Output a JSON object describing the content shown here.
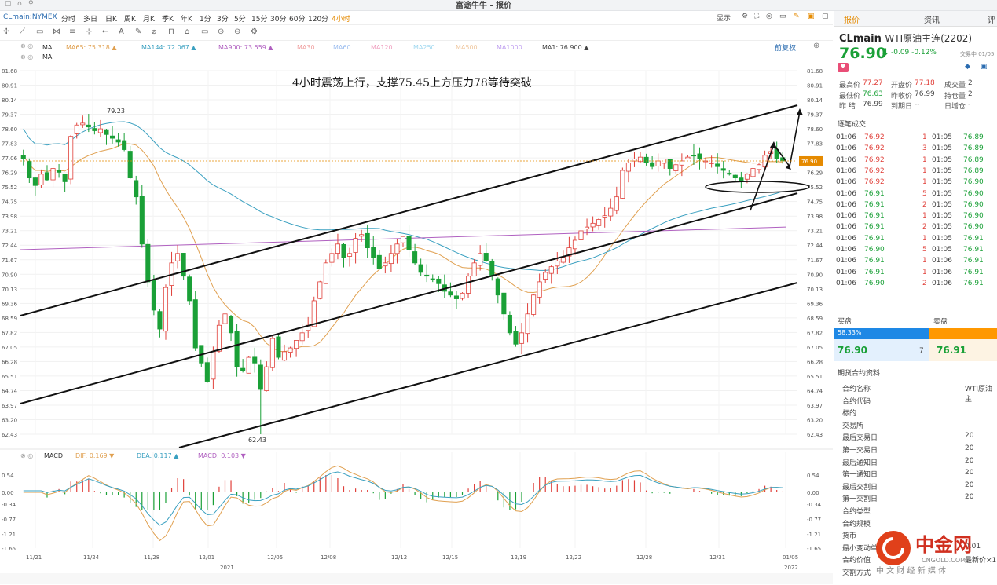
{
  "window_title": "富途牛牛 - 报价",
  "symbol_label": "CLmain:NYMEX",
  "periods": [
    "分时",
    "多日",
    "日K",
    "周K",
    "月K",
    "季K",
    "年K",
    "1分",
    "3分",
    "5分",
    "15分",
    "30分",
    "60分",
    "120分",
    "4小时"
  ],
  "active_period": "4小时",
  "top_right": {
    "display": "显示"
  },
  "toolbar_icons": [
    "cursor-icon",
    "trend-line-icon",
    "rect-icon",
    "fib-icon",
    "channel-icon",
    "measure-icon",
    "arrow-icon",
    "text-icon",
    "pencil-icon",
    "eraser-icon",
    "magnet-icon",
    "lock-icon",
    "delete-icon",
    "eye-icon",
    "layers-icon",
    "settings-icon"
  ],
  "ma_legend_row1": [
    {
      "label": "MA",
      "color": "#333333"
    },
    {
      "label": "MA65: 75.318 ▲",
      "color": "#e0a050"
    },
    {
      "label": "MA144: 72.067 ▲",
      "color": "#3aa0c0"
    },
    {
      "label": "MA900: 73.559 ▲",
      "color": "#b060c0"
    },
    {
      "label": "MA30",
      "color": "#f0a0a0"
    },
    {
      "label": "MA60",
      "color": "#a0c0f0"
    },
    {
      "label": "MA120",
      "color": "#f0a0c0"
    },
    {
      "label": "MA250",
      "color": "#a0d8f0"
    },
    {
      "label": "MA500",
      "color": "#f0c8a0"
    },
    {
      "label": "MA1000",
      "color": "#c0a0f0"
    },
    {
      "label": "MA1: 76.900 ▲",
      "color": "#444444"
    }
  ],
  "ma_legend_row2": "MA",
  "adjust_label": "前复权",
  "annotation_text": "4小时震荡上行，支撑75.45上方压力78等待突破",
  "high_label": "79.23",
  "low_label": "62.43",
  "current_price_tag": "76.90",
  "price_axis": [
    "81.68",
    "80.91",
    "80.14",
    "79.37",
    "78.60",
    "77.83",
    "77.06",
    "76.29",
    "75.52",
    "74.75",
    "73.98",
    "73.21",
    "72.44",
    "71.67",
    "70.90",
    "70.13",
    "69.36",
    "68.59",
    "67.82",
    "67.05",
    "66.28",
    "65.51",
    "64.74",
    "63.97",
    "63.20",
    "62.43"
  ],
  "macd_legend": {
    "name": "MACD",
    "dif": "DIF: 0.169 ▼",
    "dea": "DEA: 0.117 ▲",
    "macd": "MACD: 0.103 ▼"
  },
  "macd_axis": [
    "0.54",
    "0.00",
    "-0.34",
    "-0.77",
    "-1.21",
    "-1.65"
  ],
  "macd_axis_left": [
    "0.54",
    "0.00",
    "-0.34",
    "-0.77",
    "-1.21",
    "-1.65"
  ],
  "dates": [
    "11/21",
    "11/24",
    "11/28",
    "12/01",
    "12/05",
    "12/08",
    "12/12",
    "12/15",
    "12/19",
    "12/22",
    "12/28",
    "12/31",
    "01/05"
  ],
  "year_labels": [
    "2021",
    "2022"
  ],
  "chart_data": {
    "type": "candlestick",
    "title": "4小时震荡上行，支撑75.45上方压力78等待突破",
    "y_range": [
      62.43,
      81.68
    ],
    "close_path": [
      77.0,
      76.0,
      75.6,
      76.2,
      75.9,
      76.5,
      76.3,
      75.8,
      78.2,
      78.8,
      78.9,
      78.7,
      78.5,
      78.6,
      78.3,
      78.1,
      77.9,
      77.5,
      76.0,
      75.0,
      72.5,
      70.5,
      69.0,
      68.0,
      70.2,
      71.5,
      72.0,
      70.8,
      69.5,
      67.0,
      66.2,
      65.2,
      66.8,
      68.2,
      68.8,
      67.8,
      66.0,
      65.8,
      66.5,
      66.2,
      64.8,
      66.0,
      67.5,
      66.5,
      66.8,
      67.0,
      67.4,
      67.8,
      68.2,
      69.5,
      70.5,
      71.5,
      72.0,
      72.5,
      71.8,
      72.0,
      72.8,
      73.0,
      72.3,
      71.8,
      71.2,
      71.5,
      72.0,
      72.5,
      72.9,
      72.2,
      71.5,
      71.0,
      70.8,
      70.6,
      70.4,
      70.0,
      69.8,
      69.6,
      69.9,
      70.8,
      71.5,
      72.0,
      71.6,
      70.8,
      69.8,
      68.8,
      67.8,
      67.2,
      67.8,
      68.8,
      69.8,
      70.5,
      71.0,
      71.3,
      71.6,
      71.8,
      72.3,
      72.7,
      73.2,
      73.4,
      73.6,
      73.8,
      74.0,
      74.4,
      75.0,
      76.4,
      76.8,
      77.0,
      77.1,
      76.8,
      76.6,
      76.9,
      77.0,
      76.5,
      76.7,
      76.9,
      77.1,
      77.2,
      77.0,
      76.9,
      76.8,
      76.6,
      76.4,
      76.2,
      76.0,
      75.8,
      76.2,
      76.5,
      76.7,
      77.2,
      77.4,
      77.0,
      76.9
    ],
    "series": [
      {
        "name": "MA65",
        "last": 75.318
      },
      {
        "name": "MA144",
        "last": 72.067
      },
      {
        "name": "MA900",
        "last": 73.559
      }
    ],
    "support": 75.45,
    "resistance": 78.0
  },
  "right_panel": {
    "tabs": [
      "报价",
      "资讯",
      "评"
    ],
    "contract_code": "CLmain",
    "contract_name": "WTI原油主连(2202)",
    "last_price": "76.90",
    "change": "-0.09  -0.12%",
    "trading_status": "交易中 01/05",
    "stats": [
      {
        "label": "最高价",
        "value": "77.27",
        "cls": "r",
        "x": 6,
        "y": 87
      },
      {
        "label": "开盘价",
        "value": "77.18",
        "cls": "r",
        "x": 72,
        "y": 87
      },
      {
        "label": "成交量",
        "value": "2",
        "cls": "k",
        "x": 140,
        "y": 87
      },
      {
        "label": "最低价",
        "value": "76.63",
        "cls": "g",
        "x": 6,
        "y": 101
      },
      {
        "label": "昨收价",
        "value": "76.99",
        "cls": "k",
        "x": 72,
        "y": 101
      },
      {
        "label": "持仓量",
        "value": "2",
        "cls": "k",
        "x": 140,
        "y": 101
      },
      {
        "label": "昨  结",
        "value": "76.99",
        "cls": "k",
        "x": 6,
        "y": 114
      },
      {
        "label": "到期日",
        "value": "--",
        "cls": "k",
        "x": 72,
        "y": 114
      },
      {
        "label": "日增仓",
        "value": "-",
        "cls": "k",
        "x": 140,
        "y": 114
      }
    ],
    "ticks_header": "逐笔成交",
    "ticks_left": [
      [
        "01:06",
        "76.92"
      ],
      [
        "01:06",
        "76.92"
      ],
      [
        "01:06",
        "76.92"
      ],
      [
        "01:06",
        "76.92"
      ],
      [
        "01:06",
        "76.92"
      ],
      [
        "01:06",
        "76.91"
      ],
      [
        "01:06",
        "76.91"
      ],
      [
        "01:06",
        "76.91"
      ],
      [
        "01:06",
        "76.91"
      ],
      [
        "01:06",
        "76.91"
      ],
      [
        "01:06",
        "76.90"
      ],
      [
        "01:06",
        "76.91"
      ],
      [
        "01:06",
        "76.91"
      ],
      [
        "01:06",
        "76.90"
      ]
    ],
    "ticks_right": [
      [
        "1",
        "01:05",
        "76.89"
      ],
      [
        "3",
        "01:05",
        "76.89"
      ],
      [
        "1",
        "01:05",
        "76.89"
      ],
      [
        "1",
        "01:05",
        "76.89"
      ],
      [
        "1",
        "01:05",
        "76.90"
      ],
      [
        "5",
        "01:05",
        "76.90"
      ],
      [
        "2",
        "01:05",
        "76.90"
      ],
      [
        "1",
        "01:05",
        "76.90"
      ],
      [
        "2",
        "01:05",
        "76.90"
      ],
      [
        "1",
        "01:05",
        "76.91"
      ],
      [
        "5",
        "01:05",
        "76.91"
      ],
      [
        "1",
        "01:06",
        "76.91"
      ],
      [
        "1",
        "01:06",
        "76.91"
      ],
      [
        "2",
        "01:06",
        "76.91"
      ]
    ],
    "bid_label": "买盘",
    "ask_label": "卖盘",
    "bid_pct": "58.33%",
    "bid_fraction": 0.5833,
    "bid_price": "76.90",
    "bid_qty": "7",
    "ask_price": "76.91",
    "info_header": "期货合约资料",
    "info_rows": [
      [
        "合约名称",
        "WTI原油主"
      ],
      [
        "合约代码",
        ""
      ],
      [
        "标的",
        ""
      ],
      [
        "交易所",
        ""
      ],
      [
        "最后交易日",
        "20"
      ],
      [
        "第一交易日",
        "20"
      ],
      [
        "最后通知日",
        "20"
      ],
      [
        "第一通知日",
        "20"
      ],
      [
        "最后交割日",
        "20"
      ],
      [
        "第一交割日",
        "20"
      ],
      [
        "合约类型",
        ""
      ],
      [
        "合约规模",
        ""
      ],
      [
        "货币",
        ""
      ],
      [
        "最小变动单位",
        "0.01"
      ],
      [
        "合约价值",
        "最新价×1"
      ],
      [
        "交割方式",
        ""
      ]
    ]
  },
  "watermark": {
    "brand": "中金网",
    "url": "CNGOLD.COM",
    "slogan": "中 文 财 经 新 媒 体"
  }
}
